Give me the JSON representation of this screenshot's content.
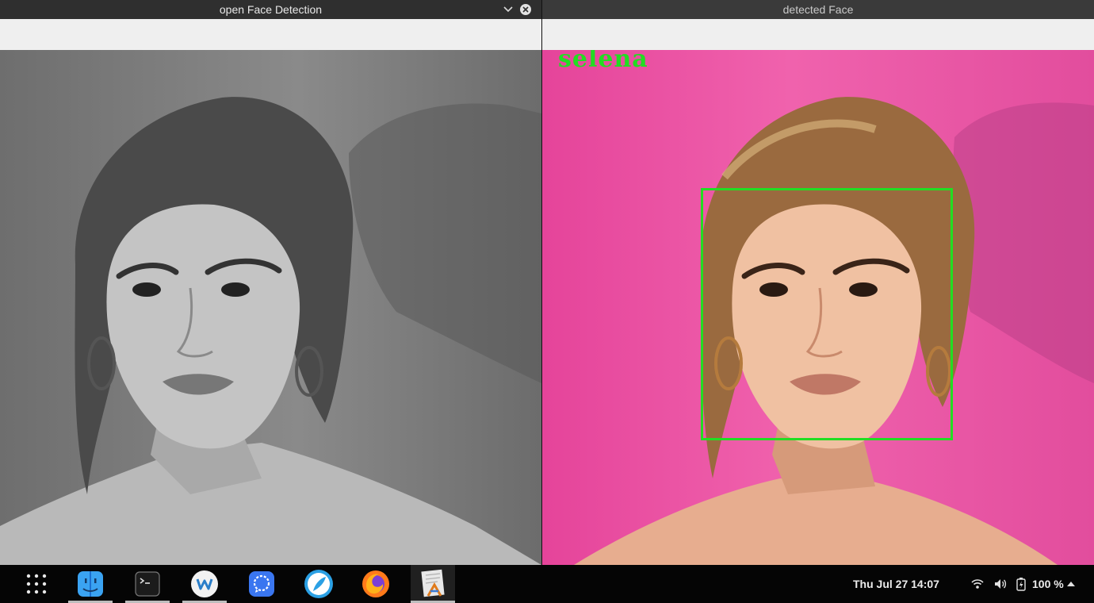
{
  "windows": {
    "left": {
      "title": "open Face Detection"
    },
    "right": {
      "title": "detected Face",
      "overlay_label": "selena"
    }
  },
  "colors": {
    "detection_box": "#22dd22",
    "right_background": "#f062ad",
    "left_background": "#7a7a7a"
  },
  "taskbar": {
    "apps": [
      {
        "name": "app-grid-icon"
      },
      {
        "name": "finder-icon"
      },
      {
        "name": "terminal-icon"
      },
      {
        "name": "kde-connect-icon"
      },
      {
        "name": "signal-icon"
      },
      {
        "name": "feather-app-icon"
      },
      {
        "name": "firefox-icon"
      },
      {
        "name": "text-editor-icon"
      }
    ],
    "clock": "Thu Jul 27  14:07",
    "battery_percent": "100 %"
  }
}
